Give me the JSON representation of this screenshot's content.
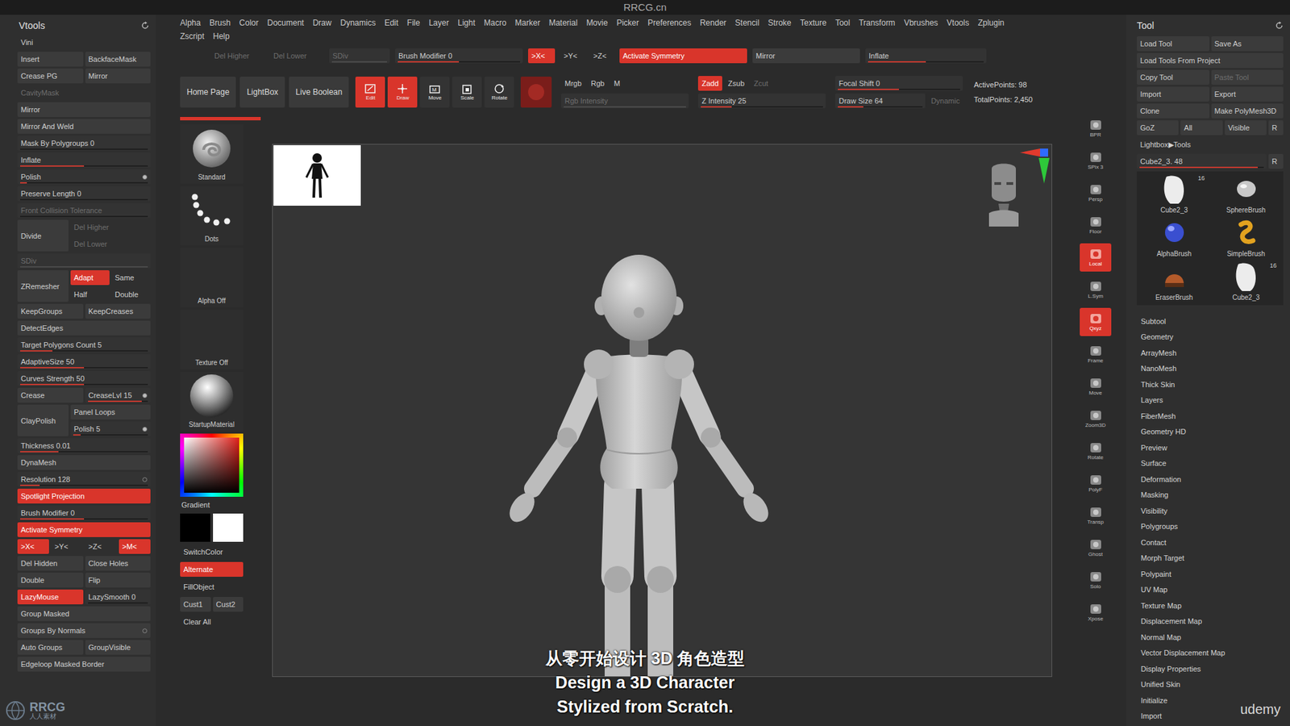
{
  "title": "RRCG.cn",
  "menu": [
    "Alpha",
    "Brush",
    "Color",
    "Document",
    "Draw",
    "Dynamics",
    "Edit",
    "File",
    "Layer",
    "Light",
    "Macro",
    "Marker",
    "Material",
    "Movie",
    "Picker",
    "Preferences",
    "Render",
    "Stencil",
    "Stroke",
    "Texture",
    "Tool",
    "Transform",
    "Vbrushes",
    "Vtools",
    "Zplugin"
  ],
  "menu2": [
    "Zscript",
    "Help"
  ],
  "toolbar": {
    "row1": [
      {
        "label": "Del Higher",
        "kind": "text",
        "disabled": true
      },
      {
        "label": "Del Lower",
        "kind": "text",
        "disabled": true
      },
      {
        "label": "SDiv",
        "kind": "slider",
        "disabled": true,
        "level": 1
      },
      {
        "label": "Brush Modifier 0",
        "kind": "slider",
        "level": 0.5
      },
      {
        "label": ">X<",
        "selected": true
      },
      {
        "label": ">Y<",
        "kind": "text"
      },
      {
        "label": ">Z<",
        "kind": "text"
      },
      {
        "label": "Activate Symmetry",
        "selected": true
      },
      {
        "label": "Mirror",
        "kind": "button"
      },
      {
        "label": "Inflate",
        "kind": "slider",
        "level": 0.5
      }
    ],
    "nav": [
      "Home Page",
      "LightBox",
      "Live Boolean"
    ],
    "tools": [
      {
        "label": "Edit",
        "kind": "edit",
        "selected": true
      },
      {
        "label": "Draw",
        "kind": "draw",
        "selected": true
      },
      {
        "label": "Move",
        "kind": "move",
        "selected": false
      },
      {
        "label": "Scale",
        "kind": "scale",
        "selected": false
      },
      {
        "label": "Rotate",
        "kind": "rotate",
        "selected": false
      }
    ],
    "swatch": {
      "color": "#7a1d1a"
    },
    "groups": [
      {
        "top": [
          {
            "label": "Mrgb",
            "kind": "text"
          },
          {
            "label": "Rgb",
            "kind": "text"
          },
          {
            "label": "M",
            "kind": "text"
          }
        ],
        "bottom": [
          {
            "label": "Rgb Intensity",
            "kind": "slider",
            "disabled": true,
            "level": 1
          }
        ]
      },
      {
        "top": [
          {
            "label": "Zadd",
            "selected": true
          },
          {
            "label": "Zsub",
            "kind": "text"
          },
          {
            "label": "Zcut",
            "kind": "text",
            "disabled": true
          }
        ],
        "bottom": [
          {
            "label": "Z Intensity 25",
            "kind": "slider",
            "level": 0.25
          }
        ]
      },
      {
        "top": [
          {
            "label": "Focal Shift 0",
            "kind": "slider",
            "level": 0.5
          }
        ],
        "bottom": [
          {
            "label": "Draw Size 64",
            "kind": "slider",
            "level": 0.3
          },
          {
            "label": "Dynamic",
            "kind": "text",
            "disabled": true
          }
        ]
      }
    ],
    "stats": [
      "ActivePoints: 98",
      "TotalPoints: 2,450"
    ]
  },
  "vtools": {
    "title": "Vtools",
    "rows": [
      {
        "cells": [
          {
            "label": "Vini",
            "kind": "text"
          }
        ]
      },
      {
        "cells": [
          {
            "label": "Insert"
          },
          {
            "label": "BackfaceMask"
          }
        ]
      },
      {
        "cells": [
          {
            "label": "Crease PG"
          },
          {
            "label": "Mirror"
          }
        ]
      },
      {
        "cells": [
          {
            "label": "CavityMask",
            "kind": "text",
            "disabled": true
          }
        ]
      },
      {
        "cells": [
          {
            "label": "Mirror"
          }
        ]
      },
      {
        "cells": [
          {
            "label": "Mirror And Weld"
          }
        ]
      },
      {
        "cells": [
          {
            "label": "Mask By Polygroups 0",
            "kind": "slider",
            "level": 0
          }
        ]
      },
      {
        "cells": [
          {
            "label": "Inflate",
            "kind": "slider",
            "level": 0.5
          }
        ]
      },
      {
        "cells": [
          {
            "label": "Polish",
            "kind": "slider",
            "level": 0.05,
            "on": true
          }
        ]
      },
      {
        "cells": [
          {
            "label": "Preserve Length 0",
            "kind": "slider",
            "level": 0
          }
        ]
      },
      {
        "cells": [
          {
            "label": "Front Collision Tolerance",
            "kind": "slider",
            "disabled": true,
            "level": 0
          }
        ]
      },
      {
        "cells": [
          {
            "label": "Divide"
          }
        ],
        "stack": [
          [
            {
              "label": "Del Higher",
              "kind": "text",
              "disabled": true
            }
          ],
          [
            {
              "label": "Del Lower",
              "kind": "text",
              "disabled": true
            }
          ]
        ]
      },
      {
        "cells": [
          {
            "label": "SDiv",
            "kind": "slider",
            "disabled": true,
            "level": 1
          }
        ]
      },
      {
        "cells": [
          {
            "label": "ZRemesher"
          }
        ],
        "stack": [
          [
            {
              "label": "Adapt",
              "selected": true
            },
            {
              "label": "Same",
              "kind": "text"
            }
          ],
          [
            {
              "label": "Half",
              "kind": "text"
            },
            {
              "label": "Double",
              "kind": "text"
            }
          ]
        ]
      },
      {
        "cells": [
          {
            "label": "KeepGroups"
          },
          {
            "label": "KeepCreases"
          }
        ]
      },
      {
        "cells": [
          {
            "label": "DetectEdges"
          }
        ]
      },
      {
        "cells": [
          {
            "label": "Target Polygons Count 5",
            "kind": "slider",
            "level": 0.25
          }
        ]
      },
      {
        "cells": [
          {
            "label": "AdaptiveSize 50",
            "kind": "slider",
            "level": 0.5
          }
        ]
      },
      {
        "cells": [
          {
            "label": "Curves Strength 50",
            "kind": "slider",
            "level": 0.5
          }
        ]
      },
      {
        "cells": [
          {
            "label": "Crease"
          },
          {
            "label": "CreaseLvl 15",
            "kind": "slider",
            "level": 0.9,
            "on": true
          }
        ]
      },
      {
        "cells": [
          {
            "label": "ClayPolish"
          }
        ],
        "stack": [
          [
            {
              "label": "Panel Loops"
            }
          ],
          [
            {
              "label": "Polish 5",
              "kind": "slider",
              "level": 0.1,
              "on": true
            }
          ]
        ]
      },
      {
        "cells": [
          {
            "label": "Thickness 0.01",
            "kind": "slider",
            "level": 0.3
          }
        ]
      },
      {
        "cells": [
          {
            "label": "DynaMesh"
          }
        ]
      },
      {
        "cells": [
          {
            "label": "Resolution 128",
            "kind": "slider",
            "level": 0.15,
            "on": false
          }
        ]
      },
      {
        "cells": [
          {
            "label": "Spotlight Projection",
            "selected": true
          }
        ]
      },
      {
        "cells": [
          {
            "label": "Brush Modifier 0",
            "kind": "slider",
            "level": 0.5
          }
        ]
      },
      {
        "cells": [
          {
            "label": "Activate Symmetry",
            "selected": true
          }
        ]
      },
      {
        "cells": [
          {
            "label": ">X<",
            "selected": true
          },
          {
            "label": ">Y<",
            "kind": "text"
          },
          {
            "label": ">Z<",
            "kind": "text"
          },
          {
            "label": ">M<",
            "selected": true
          }
        ]
      },
      {
        "cells": [
          {
            "label": "Del Hidden"
          },
          {
            "label": "Close Holes"
          }
        ]
      },
      {
        "cells": [
          {
            "label": "Double"
          },
          {
            "label": "Flip"
          }
        ]
      },
      {
        "cells": [
          {
            "label": "LazyMouse",
            "selected": true
          },
          {
            "label": "LazySmooth 0",
            "kind": "slider",
            "level": 0
          }
        ]
      },
      {
        "cells": [
          {
            "label": "Group Masked"
          }
        ]
      },
      {
        "cells": [
          {
            "label": "Groups By Normals",
            "on": false
          }
        ]
      },
      {
        "cells": [
          {
            "label": "Auto Groups"
          },
          {
            "label": "GroupVisible"
          }
        ]
      },
      {
        "cells": [
          {
            "label": "Edgeloop Masked Border"
          }
        ]
      }
    ]
  },
  "shelf": [
    {
      "label": "Standard",
      "kind": "standard"
    },
    {
      "label": "Dots",
      "kind": "dots"
    },
    {
      "label": "Alpha Off",
      "kind": "empty"
    },
    {
      "label": "Texture Off",
      "kind": "empty"
    },
    {
      "label": "StartupMaterial",
      "kind": "material"
    },
    {
      "label": "Gradient",
      "kind": "picker"
    },
    {
      "label": "SwitchColor",
      "kind": "swatches"
    },
    {
      "label": "Alternate",
      "kind": "button",
      "selected": true
    },
    {
      "label": "FillObject",
      "kind": "button",
      "selected": false
    },
    {
      "label": "Cust1 Cust2",
      "kind": "pair",
      "selected": false
    },
    {
      "label": "Clear All",
      "kind": "button",
      "selected": false
    }
  ],
  "rightShelf": [
    {
      "label": "BPR",
      "selected": false
    },
    {
      "label": "SPix 3",
      "selected": false
    },
    {
      "label": "Persp",
      "selected": false
    },
    {
      "label": "Floor",
      "selected": false
    },
    {
      "label": "Local",
      "selected": true
    },
    {
      "label": "L.Sym",
      "selected": false
    },
    {
      "label": "Qxyz",
      "selected": true
    },
    {
      "label": "Frame",
      "selected": false
    },
    {
      "label": "Move",
      "selected": false
    },
    {
      "label": "Zoom3D",
      "selected": false
    },
    {
      "label": "Rotate",
      "selected": false
    },
    {
      "label": "PolyF",
      "selected": false
    },
    {
      "label": "Transp",
      "selected": false
    },
    {
      "label": "Ghost",
      "selected": false
    },
    {
      "label": "Solo",
      "selected": false
    },
    {
      "label": "Xpose",
      "selected": false
    }
  ],
  "tool": {
    "title": "Tool",
    "rows": [
      [
        {
          "label": "Load Tool"
        },
        {
          "label": "Save As"
        }
      ],
      [
        {
          "label": "Load Tools From Project"
        }
      ],
      [
        {
          "label": "Copy Tool"
        },
        {
          "label": "Paste Tool",
          "disabled": true
        }
      ],
      [
        {
          "label": "Import"
        },
        {
          "label": "Export"
        }
      ],
      [
        {
          "label": "Clone"
        },
        {
          "label": "Make PolyMesh3D"
        }
      ],
      [
        {
          "label": "GoZ"
        },
        {
          "label": "All"
        },
        {
          "label": "Visible"
        },
        {
          "label": "R"
        }
      ]
    ],
    "lightbox": "Lightbox▶Tools",
    "current": {
      "label": "Cube2_3. 48",
      "level": 0.95,
      "button": "R"
    },
    "thumbs": [
      {
        "label": "Cube2_3",
        "kind": "cube",
        "count": "16"
      },
      {
        "label": "SphereBrush",
        "kind": "sphere",
        "count": ""
      },
      {
        "label": "AlphaBrush",
        "kind": "alpha",
        "count": ""
      },
      {
        "label": "SimpleBrush",
        "kind": "simple",
        "count": ""
      },
      {
        "label": "EraserBrush",
        "kind": "eraser",
        "count": ""
      },
      {
        "label": "Cube2_3",
        "kind": "cube",
        "count": "16"
      }
    ],
    "menu": [
      "Subtool",
      "Geometry",
      "ArrayMesh",
      "NanoMesh",
      "Thick Skin",
      "Layers",
      "FiberMesh",
      "Geometry HD",
      "Preview",
      "Surface",
      "Deformation",
      "Masking",
      "Visibility",
      "Polygroups",
      "Contact",
      "Morph Target",
      "Polypaint",
      "UV Map",
      "Texture Map",
      "Displacement Map",
      "Normal Map",
      "Vector Displacement Map",
      "Display Properties",
      "Unified Skin",
      "Initialize",
      "Import"
    ]
  },
  "subtitles": [
    "从零开始设计 3D 角色造型",
    "Design a 3D Character",
    "Stylized from Scratch."
  ],
  "watermark": {
    "logo": "RRCG",
    "sub": "人人素材",
    "brand": "udemy"
  }
}
